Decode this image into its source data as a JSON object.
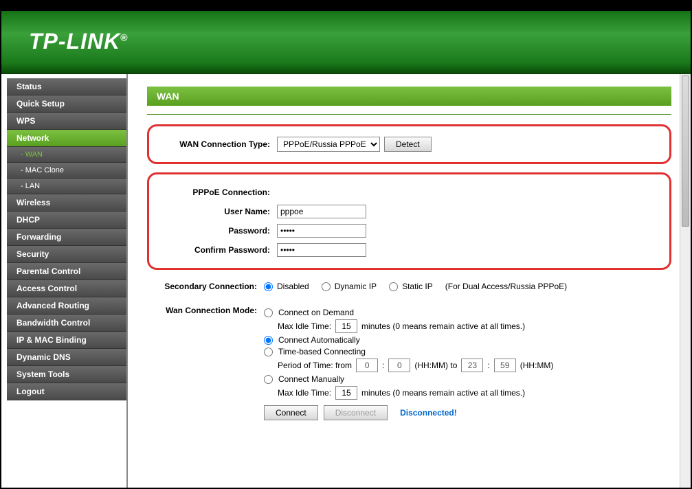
{
  "brand": "TP-LINK",
  "sidebar": {
    "items": [
      {
        "label": "Status"
      },
      {
        "label": "Quick Setup"
      },
      {
        "label": "WPS"
      },
      {
        "label": "Network",
        "active": true
      },
      {
        "label": "- WAN",
        "sub": true,
        "activeSub": true
      },
      {
        "label": "- MAC Clone",
        "sub": true
      },
      {
        "label": "- LAN",
        "sub": true
      },
      {
        "label": "Wireless"
      },
      {
        "label": "DHCP"
      },
      {
        "label": "Forwarding"
      },
      {
        "label": "Security"
      },
      {
        "label": "Parental Control"
      },
      {
        "label": "Access Control"
      },
      {
        "label": "Advanced Routing"
      },
      {
        "label": "Bandwidth Control"
      },
      {
        "label": "IP & MAC Binding"
      },
      {
        "label": "Dynamic DNS"
      },
      {
        "label": "System Tools"
      },
      {
        "label": "Logout"
      }
    ]
  },
  "page": {
    "title": "WAN"
  },
  "wan": {
    "conn_type_label": "WAN Connection Type:",
    "conn_type_value": "PPPoE/Russia PPPoE",
    "detect_btn": "Detect",
    "pppoe_header": "PPPoE Connection:",
    "username_label": "User Name:",
    "username_value": "pppoe",
    "password_label": "Password:",
    "password_value": "•••••",
    "confirm_label": "Confirm Password:",
    "confirm_value": "•••••",
    "secondary_label": "Secondary Connection:",
    "secondary_options": {
      "disabled": "Disabled",
      "dynamic": "Dynamic IP",
      "static": "Static IP"
    },
    "secondary_note": "(For Dual Access/Russia PPPoE)",
    "mode_label": "Wan Connection Mode:",
    "mode": {
      "demand": "Connect on Demand",
      "demand_idle_label": "Max Idle Time:",
      "demand_idle_value": "15",
      "idle_note": "minutes (0 means remain active at all times.)",
      "auto": "Connect Automatically",
      "time": "Time-based Connecting",
      "time_label": "Period of Time: from",
      "time_from_h": "0",
      "time_from_m": "0",
      "time_mid": "(HH:MM) to",
      "time_to_h": "23",
      "time_to_m": "59",
      "time_end": "(HH:MM)",
      "manual": "Connect Manually",
      "manual_idle_value": "15"
    },
    "connect_btn": "Connect",
    "disconnect_btn": "Disconnect",
    "status": "Disconnected!"
  }
}
